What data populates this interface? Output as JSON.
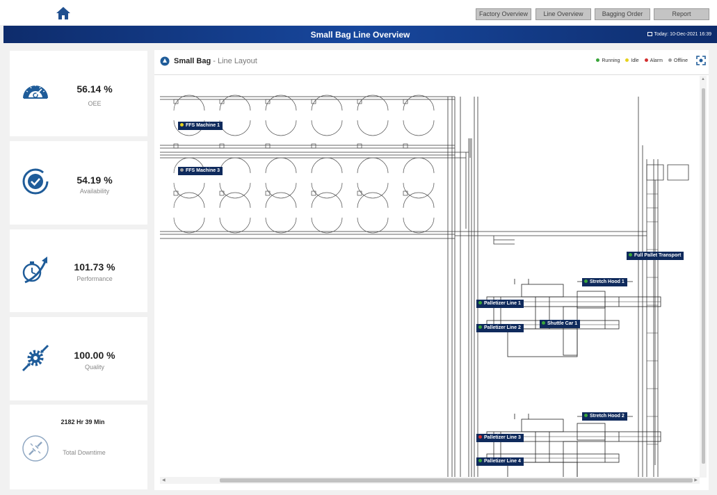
{
  "nav": {
    "buttons": [
      "Factory Overview",
      "Line Overview",
      "Bagging Order",
      "Report"
    ]
  },
  "header": {
    "title": "Small Bag Line Overview",
    "date": "Today: 10-Dec-2021 16:39"
  },
  "kpis": [
    {
      "value": "56.14 %",
      "label": "OEE",
      "icon": "speedometer-icon"
    },
    {
      "value": "54.19 %",
      "label": "Availability",
      "icon": "check-circle-icon"
    },
    {
      "value": "101.73 %",
      "label": "Performance",
      "icon": "stopwatch-arrow-icon"
    },
    {
      "value": "100.00 %",
      "label": "Quality",
      "icon": "gear-arrows-icon"
    }
  ],
  "downtime": {
    "value": "2182 Hr 39 Min",
    "label": "Total Downtime",
    "icon": "disconnect-icon"
  },
  "panel": {
    "title_bold": "Small Bag",
    "title_rest": " - Line Layout"
  },
  "legend": [
    {
      "label": "Running",
      "color": "#3aa53a"
    },
    {
      "label": "Idle",
      "color": "#e6d21c"
    },
    {
      "label": "Alarm",
      "color": "#d32f2f"
    },
    {
      "label": "Offline",
      "color": "#9e9e9e"
    }
  ],
  "machines": [
    {
      "label": "FFS Machine 1",
      "status": "Idle"
    },
    {
      "label": "FFS Machine 3",
      "status": "Offline"
    },
    {
      "label": "Full Pallet Transport",
      "status": "Running"
    },
    {
      "label": "Stretch Hood 1",
      "status": "Running"
    },
    {
      "label": "Palletizer Line 1",
      "status": "Running"
    },
    {
      "label": "Shuttle Car 1",
      "status": "Running"
    },
    {
      "label": "Palletizer Line 2",
      "status": "Running"
    },
    {
      "label": "Stretch Hood 2",
      "status": "Running"
    },
    {
      "label": "Palletizer Line 3",
      "status": "Alarm"
    },
    {
      "label": "Palletizer Line 4",
      "status": "Running"
    }
  ],
  "colors": {
    "brand": "#17479d",
    "label_bg": "#0f2a5c",
    "icon": "#1f5c99"
  }
}
